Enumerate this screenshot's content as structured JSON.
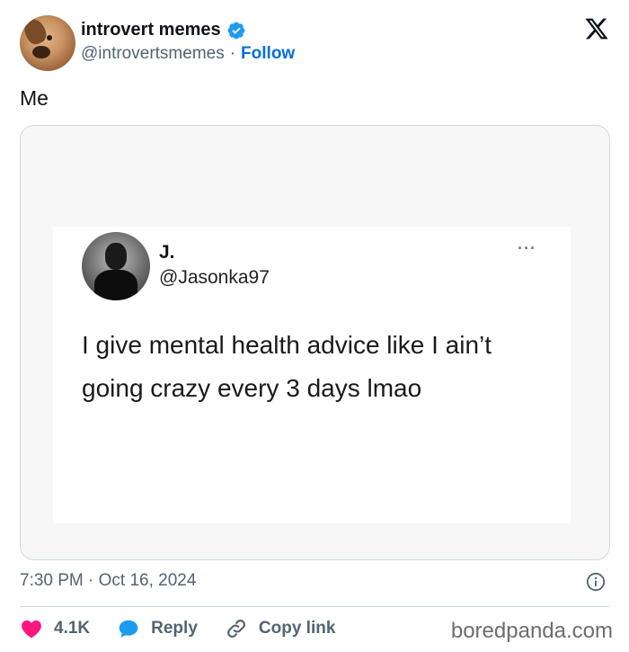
{
  "author": {
    "name": "introvert memes",
    "handle": "@introvertsmemes",
    "separator": "·",
    "follow_label": "Follow"
  },
  "tweet": {
    "text": "Me"
  },
  "embedded_post": {
    "name": "J.",
    "handle": "@Jasonka97",
    "more": "···",
    "line1": "I give mental health advice like I ain’t",
    "line2": "going crazy every 3 days lmao"
  },
  "meta": {
    "timestamp": "7:30 PM · Oct 16, 2024"
  },
  "actions": {
    "likes": "4.1K",
    "reply_label": "Reply",
    "copy_label": "Copy link"
  },
  "watermark": "boredpanda.com",
  "colors": {
    "follow": "#006fd6",
    "verified": "#1d9bf0",
    "like": "#f91880",
    "reply": "#1d9bf0",
    "muted": "#536471"
  },
  "icons": [
    "x-logo-icon",
    "verified-badge-icon",
    "info-icon",
    "heart-icon",
    "reply-bubble-icon",
    "link-icon",
    "more-dots-icon"
  ]
}
